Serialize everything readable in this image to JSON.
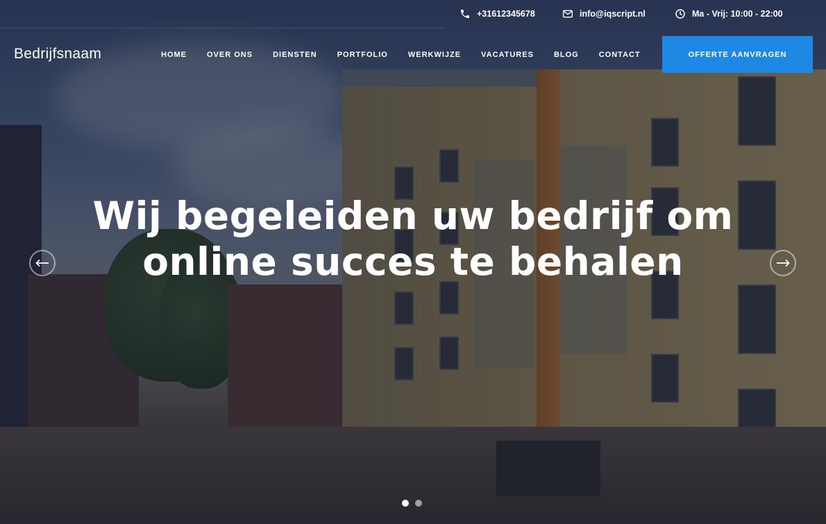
{
  "topbar": {
    "phone": "+31612345678",
    "email": "info@iqscript.nl",
    "hours": "Ma - Vrij: 10:00 - 22:00"
  },
  "brand": {
    "name": "Bedrijfsnaam"
  },
  "nav": {
    "items": [
      "HOME",
      "OVER ONS",
      "DIENSTEN",
      "PORTFOLIO",
      "WERKWIJZE",
      "VACATURES",
      "BLOG",
      "CONTACT"
    ],
    "cta": "OFFERTE AANVRAGEN"
  },
  "hero": {
    "line1": "Wij begeleiden uw bedrijf om",
    "line2": "online succes te behalen"
  },
  "slider": {
    "slides": 2,
    "active_index": 0
  },
  "colors": {
    "accent": "#1e88e5",
    "text": "#ffffff"
  },
  "icons": {
    "phone": "phone-icon",
    "email": "envelope-icon",
    "hours": "clock-icon",
    "prev": "arrow-left-icon",
    "next": "arrow-right-icon"
  }
}
